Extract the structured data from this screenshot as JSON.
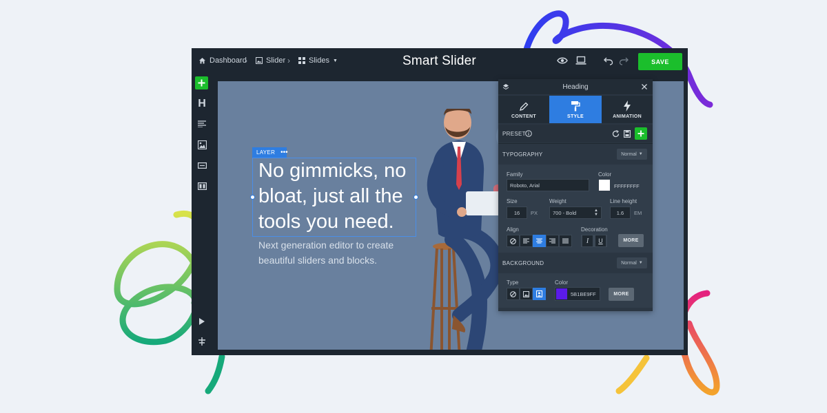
{
  "topbar": {
    "breadcrumb": [
      {
        "label": "Dashboard",
        "icon": "home-icon"
      },
      {
        "label": "Slider",
        "icon": "image-icon"
      },
      {
        "label": "Slides",
        "icon": "grid-icon"
      }
    ],
    "logo": "Smart Slider",
    "save_label": "SAVE",
    "icons": [
      "eye-icon",
      "laptop-icon",
      "undo-icon",
      "redo-icon"
    ]
  },
  "sidebar": {
    "items": [
      "add-icon",
      "heading-icon",
      "text-icon",
      "image-icon",
      "button-icon",
      "row-icon",
      "play-icon",
      "structure-icon"
    ]
  },
  "canvas": {
    "layer_tag": "LAYER",
    "heading_lines": [
      "No gimmicks, no",
      "bloat, just all the",
      "tools you need."
    ],
    "sub_lines": [
      "Next generation editor to create",
      "beautiful sliders and blocks."
    ]
  },
  "panel": {
    "title": "Heading",
    "tabs": [
      {
        "label": "CONTENT",
        "icon": "pencil-icon",
        "active": false
      },
      {
        "label": "STYLE",
        "icon": "paint-roller-icon",
        "active": true
      },
      {
        "label": "ANIMATION",
        "icon": "lightning-icon",
        "active": false
      }
    ],
    "preset_label": "PRESET",
    "typography": {
      "section_label": "TYPOGRAPHY",
      "mode": "Normal",
      "family_label": "Family",
      "family_value": "Roboto, Arial",
      "color_label": "Color",
      "color_value": "FFFFFFFF",
      "size_label": "Size",
      "size_value": "16",
      "size_unit": "PX",
      "weight_label": "Weight",
      "weight_value": "700 - Bold",
      "line_height_label": "Line height",
      "line_height_value": "1.6",
      "line_height_unit": "EM",
      "align_label": "Align",
      "decoration_label": "Decoration",
      "more_label": "MORE"
    },
    "background": {
      "section_label": "BACKGROUND",
      "mode": "Normal",
      "type_label": "Type",
      "color_label": "Color",
      "color_value": "5B1BE9FF",
      "more_label": "MORE"
    }
  },
  "colors": {
    "accent": "#2e7de1",
    "save": "#1bbe2c",
    "canvas_bg": "#69809e",
    "bg_swatch": "#5b1be9",
    "text_swatch": "#ffffff"
  }
}
